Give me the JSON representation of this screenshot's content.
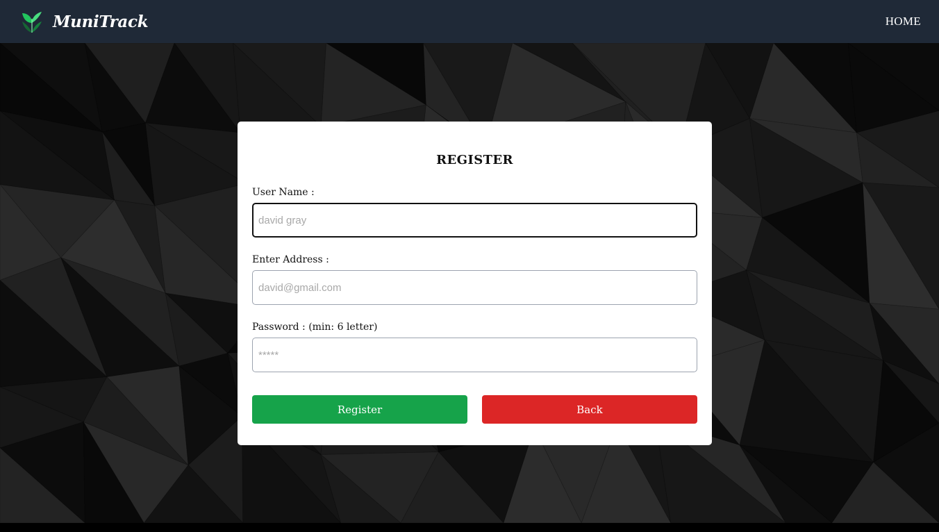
{
  "navbar": {
    "brand_name": "MuniTrack",
    "brand_icon": "leaf-logo-icon",
    "home_label": "HOME"
  },
  "form": {
    "title": "REGISTER",
    "username": {
      "label": "User Name :",
      "placeholder": "david gray",
      "value": ""
    },
    "address": {
      "label": "Enter Address :",
      "placeholder": "david@gmail.com",
      "value": ""
    },
    "password": {
      "label": "Password : (min: 6 letter)",
      "placeholder": "*****",
      "value": ""
    },
    "register_label": "Register",
    "back_label": "Back"
  },
  "colors": {
    "navbar_bg": "#1f2937",
    "register_button": "#16a34a",
    "back_button": "#dc2626",
    "logo_green": "#4ade80"
  }
}
